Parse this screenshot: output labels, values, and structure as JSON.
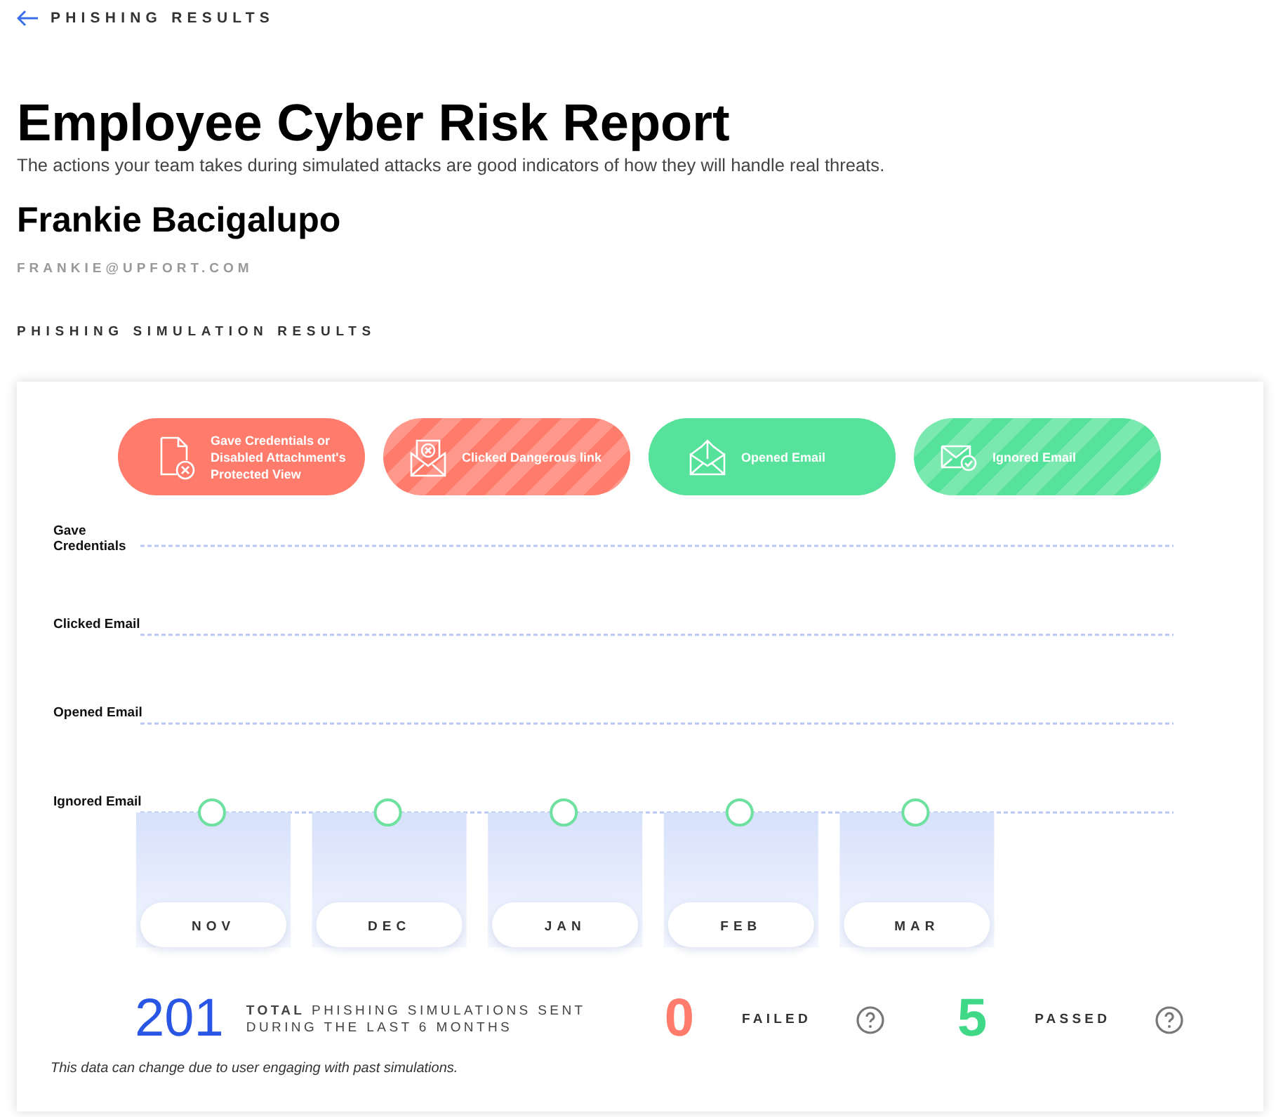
{
  "back_link": {
    "label": "PHISHING RESULTS"
  },
  "title": "Employee Cyber Risk Report",
  "subtitle": "The actions your team takes during simulated attacks are good indicators of how they will handle real threats.",
  "employee": {
    "name": "Frankie Bacigalupo",
    "email": "FRANKIE@UPFORT.COM"
  },
  "section_title": "PHISHING SIMULATION RESULTS",
  "legend": [
    {
      "kind": "document",
      "label": "Gave Credentials or Disabled Attachment's Protected View",
      "color": "#ff7b6b",
      "striped": false
    },
    {
      "kind": "shield",
      "label": "Clicked Dangerous link",
      "color": "#ff7b6b",
      "striped": true
    },
    {
      "kind": "opened",
      "label": "Opened Email",
      "color": "#56e29a",
      "striped": false
    },
    {
      "kind": "ignored",
      "label": "Ignored Email",
      "color": "#56e29a",
      "striped": true
    }
  ],
  "timeline": {
    "levels": [
      {
        "label": "Gave Credentials",
        "kind": "credentials"
      },
      {
        "label": "Clicked Email",
        "kind": "clicked"
      },
      {
        "label": "Opened Email",
        "kind": "opened"
      },
      {
        "label": "Ignored Email",
        "kind": "ignored"
      }
    ],
    "months": [
      {
        "label": "NOV",
        "kind": "ignored"
      },
      {
        "label": "DEC",
        "kind": "ignored"
      },
      {
        "label": "JAN",
        "kind": "ignored"
      },
      {
        "label": "FEB",
        "kind": "ignored"
      },
      {
        "label": "MAR",
        "kind": "ignored"
      }
    ]
  },
  "summary": {
    "total": "201",
    "total_label_bold": "TOTAL",
    "total_label": "PHISHING SIMULATIONS SENT DURING THE LAST 6 MONTHS",
    "failed": "0",
    "failed_label": "FAILED",
    "passed": "5",
    "passed_label": "PASSED"
  },
  "note": "This data can change due to user engaging with past simulations."
}
